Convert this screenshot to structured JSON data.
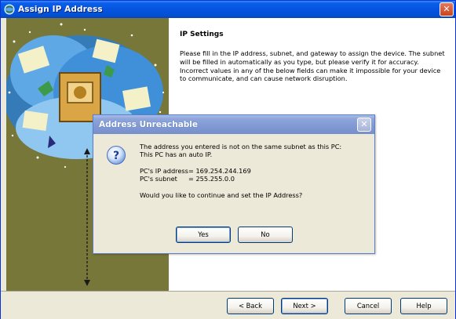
{
  "window": {
    "title": "Assign IP Address",
    "close_icon": "close-icon",
    "app_icon": "globe-icon"
  },
  "main": {
    "heading": "IP Settings",
    "description": "Please fill in the IP address, subnet, and gateway to assign the device. The subnet will be filled in automatically as you type, but please verify it for accuracy.  Incorrect values in any of the below fields can make it impossible for your device to communicate, and can cause network disruption."
  },
  "footer": {
    "back_label": "< Back",
    "next_label": "Next >",
    "cancel_label": "Cancel",
    "help_label": "Help"
  },
  "dialog": {
    "title": "Address Unreachable",
    "icon": "question-icon",
    "line1": "The address you entered is not on the same subnet as this PC:",
    "line2": "This PC has an auto IP.",
    "pc_ip_key": "PC's IP address",
    "pc_ip_value": "= 169.254.244.169",
    "pc_subnet_key": "PC's subnet",
    "pc_subnet_value": "= 255.255.0.0",
    "question": "Would you like to continue and set the IP Address?",
    "yes_label": "Yes",
    "no_label": "No"
  },
  "colors": {
    "titlebar_blue": "#0554e1",
    "art_olive": "#78773a",
    "dialog_title": "#8099d3",
    "dialog_bg": "#ece9d8"
  }
}
